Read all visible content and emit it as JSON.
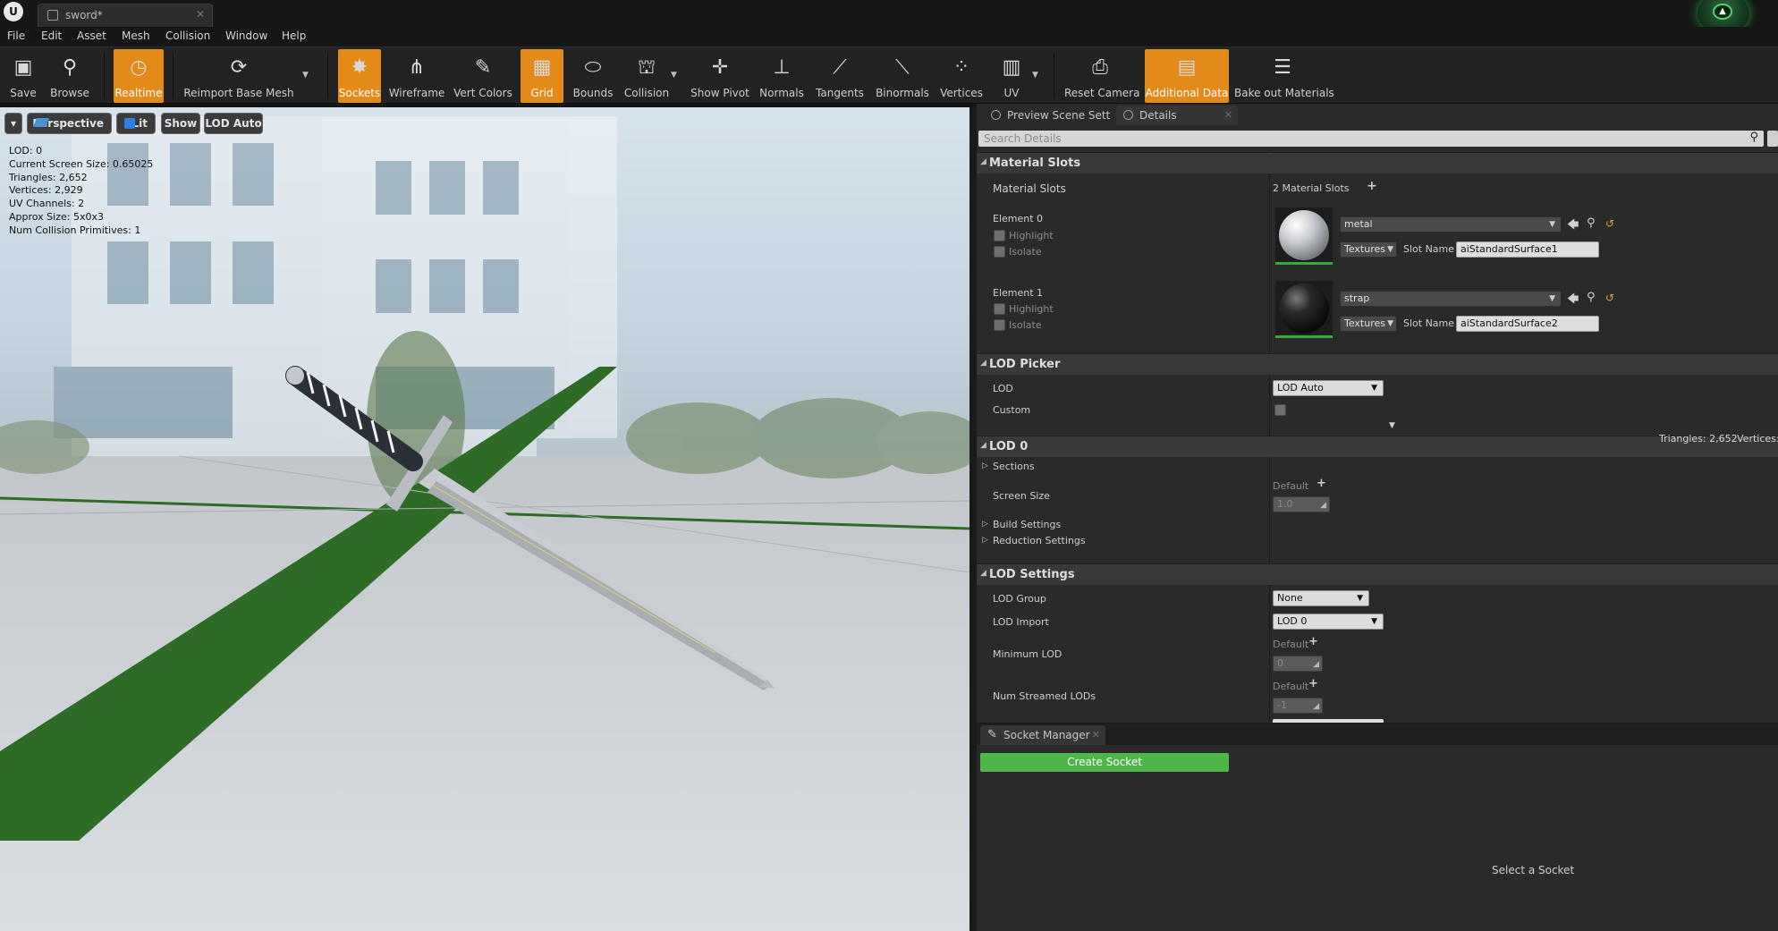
{
  "titlebar": {
    "tab_title": "sword*"
  },
  "menu": [
    "File",
    "Edit",
    "Asset",
    "Mesh",
    "Collision",
    "Window",
    "Help"
  ],
  "toolbar": {
    "buttons": [
      {
        "label": "Save",
        "active": false
      },
      {
        "label": "Browse",
        "active": false
      },
      {
        "label": "Realtime",
        "active": true
      },
      {
        "label": "Reimport Base Mesh",
        "active": false
      },
      {
        "label": "Sockets",
        "active": true
      },
      {
        "label": "Wireframe",
        "active": false
      },
      {
        "label": "Vert Colors",
        "active": false
      },
      {
        "label": "Grid",
        "active": true
      },
      {
        "label": "Bounds",
        "active": false
      },
      {
        "label": "Collision",
        "active": false
      },
      {
        "label": "Show Pivot",
        "active": false
      },
      {
        "label": "Normals",
        "active": false
      },
      {
        "label": "Tangents",
        "active": false
      },
      {
        "label": "Binormals",
        "active": false
      },
      {
        "label": "Vertices",
        "active": false
      },
      {
        "label": "UV",
        "active": false
      },
      {
        "label": "Reset Camera",
        "active": false
      },
      {
        "label": "Additional Data",
        "active": true
      },
      {
        "label": "Bake out Materials",
        "active": false
      }
    ]
  },
  "viewport": {
    "buttons": {
      "perspective": "Perspective",
      "lit": "Lit",
      "show": "Show",
      "lod": "LOD Auto"
    },
    "stats": [
      "LOD:  0",
      "Current Screen Size:  0.65025",
      "Triangles:  2,652",
      "Vertices:  2,929",
      "UV Channels:  2",
      "Approx Size: 5x0x3",
      "Num Collision Primitives:  1"
    ]
  },
  "panel": {
    "tabs": {
      "preview": "Preview Scene Sett",
      "details": "Details"
    },
    "search_placeholder": "Search Details",
    "material_slots": {
      "header": "Material Slots",
      "label": "Material Slots",
      "count": "2 Material Slots",
      "elements": [
        {
          "name": "Element 0",
          "material": "metal",
          "textures": "Textures",
          "slot_name_label": "Slot Name",
          "slot_name": "aiStandardSurface1",
          "highlight": "Highlight",
          "isolate": "Isolate"
        },
        {
          "name": "Element 1",
          "material": "strap",
          "textures": "Textures",
          "slot_name_label": "Slot Name",
          "slot_name": "aiStandardSurface2",
          "highlight": "Highlight",
          "isolate": "Isolate"
        }
      ]
    },
    "lod_picker": {
      "header": "LOD Picker",
      "lod_label": "LOD",
      "lod_value": "LOD Auto",
      "custom_label": "Custom"
    },
    "lod0": {
      "header": "LOD 0",
      "triangles": "Triangles: 2,652",
      "vertices": "Vertices:",
      "sections": "Sections",
      "screen_size_label": "Screen Size",
      "default_label": "Default",
      "screen_size_value": "1.0",
      "build_settings": "Build Settings",
      "reduction_settings": "Reduction Settings"
    },
    "lod_settings": {
      "header": "LOD Settings",
      "lod_group_label": "LOD Group",
      "lod_group_value": "None",
      "lod_import_label": "LOD Import",
      "lod_import_value": "LOD 0",
      "min_lod_label": "Minimum LOD",
      "default_label": "Default",
      "min_lod_value": "0",
      "num_streamed_label": "Num Streamed LODs",
      "num_streamed_value": "-1"
    },
    "socket_manager": {
      "tab": "Socket Manager",
      "create_button": "Create Socket",
      "empty_text": "Select a Socket"
    }
  },
  "colors": {
    "accent_orange": "#e38a19",
    "create_green": "#4db54a",
    "grid_green": "#2d6b26"
  }
}
